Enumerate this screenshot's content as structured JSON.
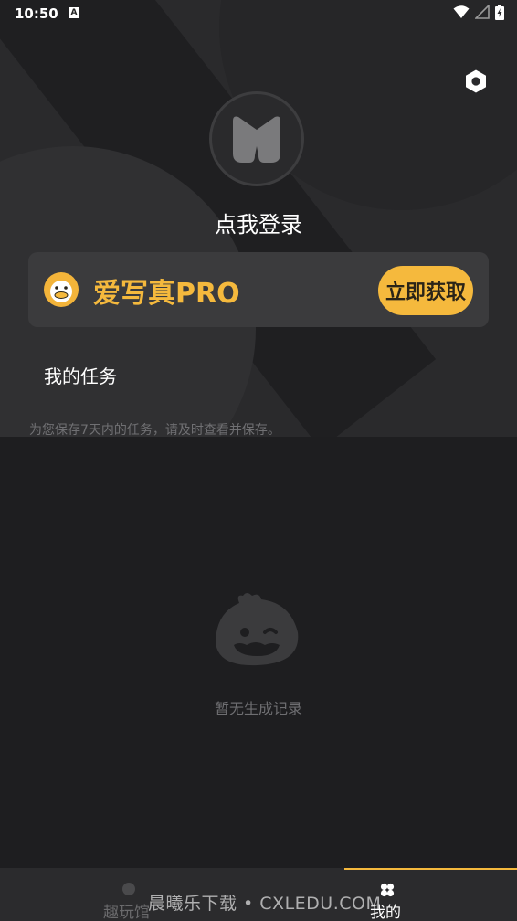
{
  "status_bar": {
    "time": "10:50",
    "indicator": "A"
  },
  "header": {
    "settings_icon": "settings-hexagon-icon",
    "avatar_icon": "m-logo-icon",
    "login_text": "点我登录"
  },
  "pro_card": {
    "title": "爱写真PRO",
    "button_label": "立即获取",
    "icon": "duck-mascot-icon",
    "accent_color": "#f5b93d"
  },
  "tasks": {
    "title": "我的任务",
    "description": "为您保存7天内的任务，请及时查看并保存。"
  },
  "empty_state": {
    "icon": "mascot-face-icon",
    "message": "暂无生成记录"
  },
  "bottom_nav": {
    "items": [
      {
        "label": "趣玩馆",
        "icon": "fun-icon",
        "active": false
      },
      {
        "label": "我的",
        "icon": "clover-icon",
        "active": true
      }
    ]
  },
  "watermark": "晨曦乐下载 • CXLEDU.COM"
}
